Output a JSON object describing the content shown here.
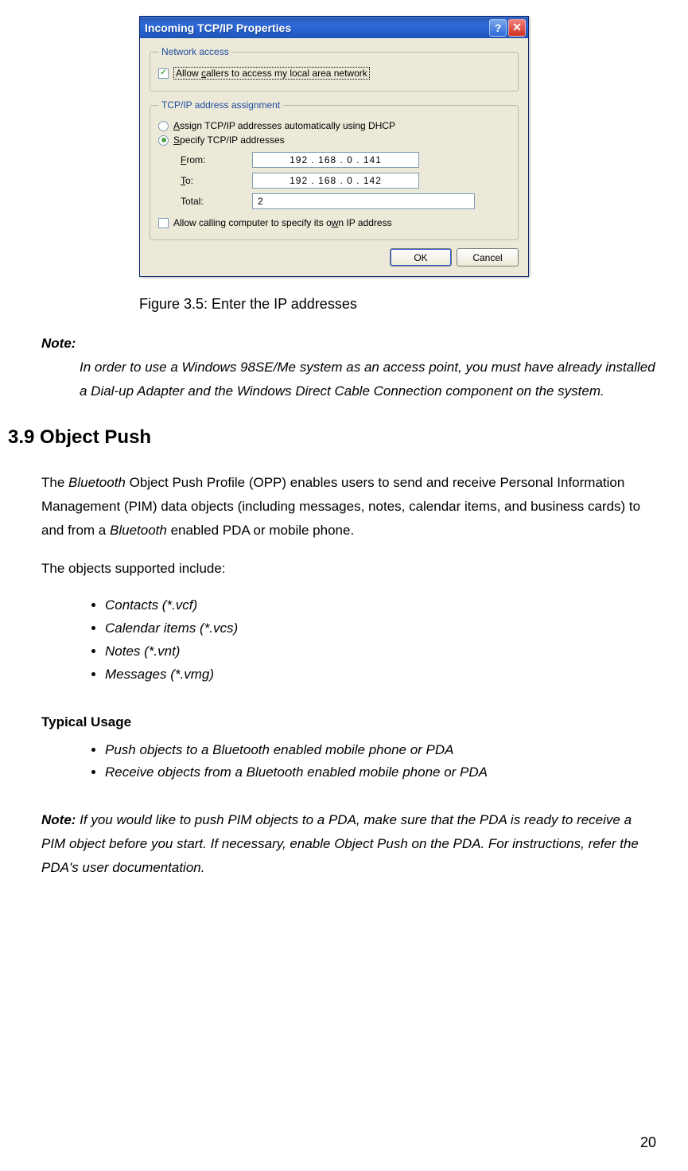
{
  "dialog": {
    "title": "Incoming TCP/IP Properties",
    "group1_legend": "Network access",
    "allow_callers_label": "Allow callers to access my local area network",
    "allow_callers_checked": true,
    "group2_legend": "TCP/IP address assignment",
    "radio_dhcp_label": "Assign TCP/IP addresses automatically using DHCP",
    "radio_specify_label": "Specify TCP/IP addresses",
    "from_label": "From:",
    "from_value": "192 . 168 .   0   . 141",
    "to_label": "To:",
    "to_value": "192 . 168 .   0   . 142",
    "total_label": "Total:",
    "total_value": "2",
    "allow_calling_label": "Allow calling computer to specify its own IP address",
    "ok_label": "OK",
    "cancel_label": "Cancel"
  },
  "doc": {
    "figure_caption": "Figure 3.5: Enter the IP addresses",
    "note_heading": "Note:",
    "note_body": "In order to use a Windows 98SE/Me system as an access point, you must have already installed a Dial-up Adapter and the Windows Direct Cable Connection component on the system.",
    "section_number": "3.9",
    "section_title": "Object Push",
    "para1_a": "The ",
    "para1_b": "Bluetooth",
    "para1_c": " Object Push Profile (OPP) enables users to send and receive Personal Information Management (PIM) data objects (including messages, notes, calendar items, and business cards) to and from a ",
    "para1_d": "Bluetooth",
    "para1_e": " enabled PDA or mobile phone.",
    "supported_intro": "The objects supported include:",
    "supported_items": [
      "Contacts (*.vcf)",
      "Calendar items (*.vcs)",
      "Notes (*.vnt)",
      "Messages (*.vmg)"
    ],
    "typical_heading": "Typical Usage",
    "typical_items": [
      "Push objects to a Bluetooth enabled mobile phone or PDA",
      "Receive objects from a Bluetooth enabled mobile phone or PDA"
    ],
    "note2_lead": "Note:",
    "note2_body": " If you would like to push PIM objects to a PDA, make sure that the PDA is ready to receive a PIM object before you start. If necessary, enable Object Push on the PDA. For instructions, refer the PDA's user documentation.",
    "page_number": "20"
  }
}
